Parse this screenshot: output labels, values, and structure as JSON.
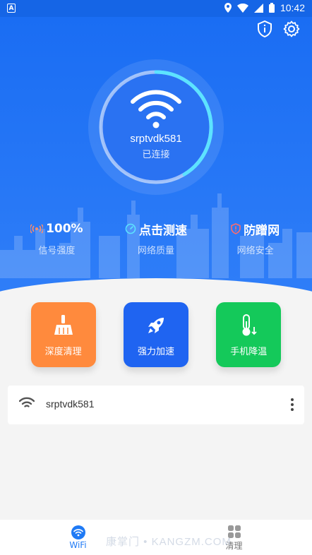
{
  "status_bar": {
    "time": "10:42"
  },
  "hero": {
    "ssid": "srptvdk581",
    "connection_status": "已连接",
    "stats": [
      {
        "value": "100%",
        "label": "信号强度",
        "icon": "signal-icon"
      },
      {
        "value": "点击测速",
        "label": "网络质量",
        "icon": "speedometer-icon"
      },
      {
        "value": "防蹭网",
        "label": "网络安全",
        "icon": "shield-icon"
      }
    ]
  },
  "tools": [
    {
      "label": "深度清理",
      "icon": "broom-icon",
      "color": "#ff8a3d"
    },
    {
      "label": "强力加速",
      "icon": "rocket-icon",
      "color": "#1f64f1"
    },
    {
      "label": "手机降温",
      "icon": "thermometer-icon",
      "color": "#14c95a"
    }
  ],
  "network_list": [
    {
      "ssid": "srptvdk581"
    }
  ],
  "bottom_nav": [
    {
      "label": "WiFi",
      "active": true
    },
    {
      "label": "清理",
      "active": false
    }
  ],
  "watermark": "康掌门 • KANGZM.COM",
  "colors": {
    "primary": "#1a6df3",
    "ring_progress": "#5ce3ff"
  }
}
